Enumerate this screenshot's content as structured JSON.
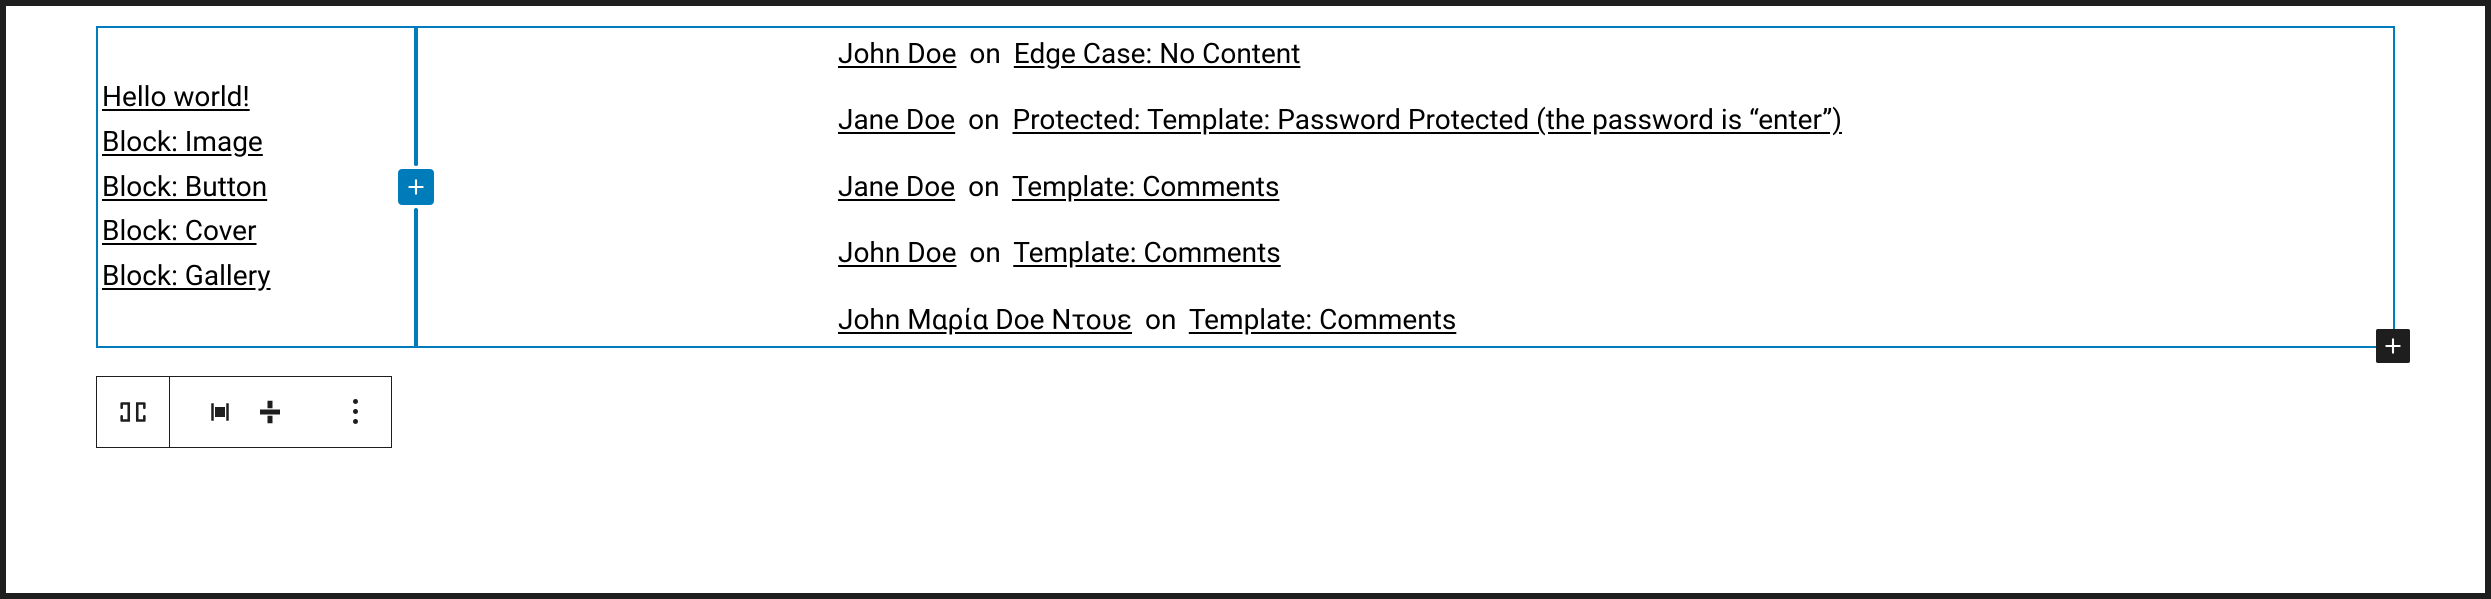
{
  "left_column": {
    "posts": [
      {
        "title": "Hello world!"
      },
      {
        "title": "Block: Image"
      },
      {
        "title": "Block: Button"
      },
      {
        "title": "Block: Cover"
      },
      {
        "title": "Block: Gallery"
      }
    ]
  },
  "right_column": {
    "comments": [
      {
        "author": "John Doe",
        "on": "on",
        "post": "Edge Case: No Content"
      },
      {
        "author": "Jane Doe",
        "on": "on",
        "post": "Protected: Template: Password Protected (the password is “enter”)"
      },
      {
        "author": "Jane Doe",
        "on": "on",
        "post": "Template: Comments"
      },
      {
        "author": "John Doe",
        "on": "on",
        "post": "Template: Comments"
      },
      {
        "author": "John Μαρία Doe Ντουε",
        "on": "on",
        "post": "Template: Comments"
      }
    ]
  },
  "icons": {
    "plus": "plus-icon",
    "columns": "columns-icon",
    "align": "align-icon",
    "valign": "vertical-align-icon",
    "more": "more-icon"
  },
  "colors": {
    "accent": "#007cba",
    "dark": "#1e1e1e"
  }
}
